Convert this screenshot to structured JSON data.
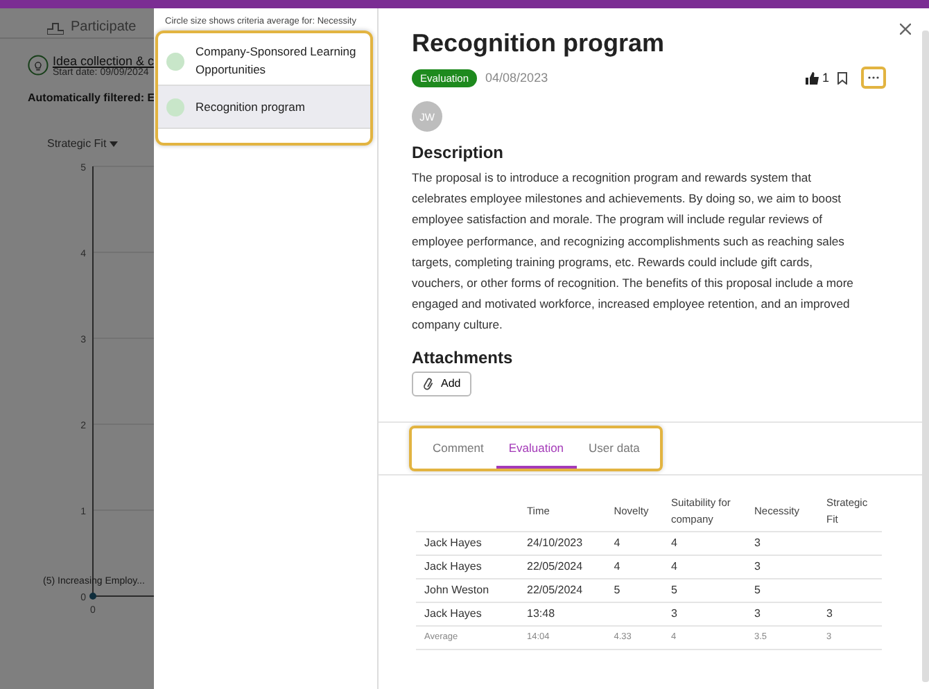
{
  "background": {
    "tab": "Participate",
    "phase": {
      "title": "Idea collection & c",
      "start": "Start date: 09/09/2024"
    },
    "filter": "Automatically filtered: E",
    "axis_select": "Strategic Fit",
    "chart": {
      "y_ticks": [
        "5",
        "4",
        "3",
        "2",
        "1",
        "0"
      ],
      "x_tick": "0",
      "point_label": "(5) Increasing Employ..."
    }
  },
  "list": {
    "caption": "Circle size shows criteria average for: Necessity",
    "items": [
      {
        "title": "Company-Sponsored Learning Opportunities",
        "selected": false,
        "color": "#c8e6c9"
      },
      {
        "title": "Recognition program",
        "selected": true,
        "color": "#c8e6c9"
      }
    ]
  },
  "detail": {
    "title": "Recognition program",
    "status": "Evaluation",
    "date": "04/08/2023",
    "likes": "1",
    "avatar": "JW",
    "description_heading": "Description",
    "description": "The proposal is to introduce a recognition program and rewards system that celebrates employee milestones and achievements. By doing so, we aim to boost employee satisfaction and morale. The program will include regular reviews of employee performance, and recognizing accomplishments such as reaching sales targets, completing training programs, etc. Rewards could include gift cards, vouchers, or other forms of recognition. The benefits of this proposal include a more engaged and motivated workforce, increased employee retention, and an improved company culture.",
    "attachments_heading": "Attachments",
    "add_button": "Add",
    "tabs": [
      {
        "label": "Comment",
        "selected": false
      },
      {
        "label": "Evaluation",
        "selected": true
      },
      {
        "label": "User data",
        "selected": false
      }
    ],
    "table": {
      "columns": [
        "",
        "Time",
        "Novelty",
        "Suitability for company",
        "Necessity",
        "Strategic Fit"
      ],
      "rows": [
        [
          "Jack Hayes",
          "24/10/2023",
          "4",
          "4",
          "3",
          ""
        ],
        [
          "Jack Hayes",
          "22/05/2024",
          "4",
          "4",
          "3",
          ""
        ],
        [
          "John Weston",
          "22/05/2024",
          "5",
          "5",
          "5",
          ""
        ],
        [
          "Jack Hayes",
          "13:48",
          "",
          "3",
          "3",
          "3"
        ]
      ],
      "average": [
        "Average",
        "14:04",
        "4.33",
        "4",
        "3.5",
        "3"
      ]
    }
  }
}
